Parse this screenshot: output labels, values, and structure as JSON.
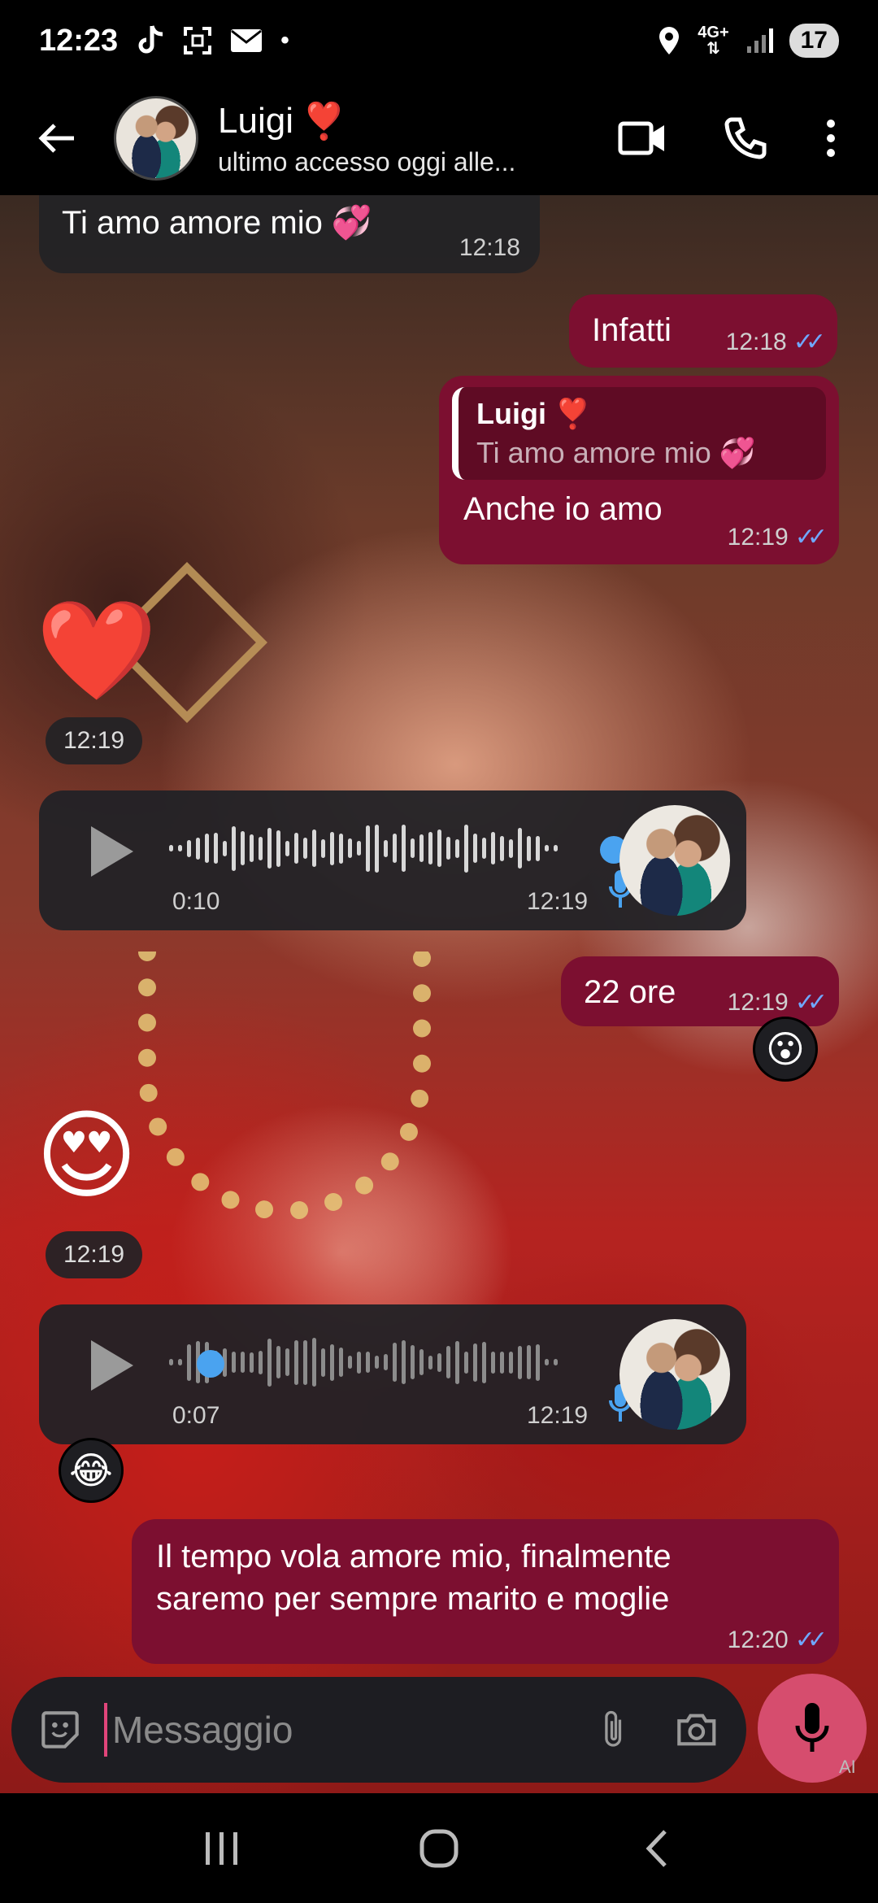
{
  "status_bar": {
    "time": "12:23",
    "network": "4G+",
    "battery": "17",
    "notification_icons": [
      "tiktok-icon",
      "screenshot-icon",
      "mail-icon",
      "dot-icon"
    ],
    "system_icons": [
      "location-icon",
      "network-arrows-icon",
      "signal-icon",
      "battery-icon"
    ]
  },
  "header": {
    "contact_name": "Luigi",
    "contact_emoji": "❣️",
    "last_seen": "ultimo accesso oggi alle...",
    "actions": [
      "video-call-icon",
      "voice-call-icon",
      "more-options-icon"
    ]
  },
  "messages": {
    "m1": {
      "text": "Ti amo amore mio 💞",
      "time": "12:18"
    },
    "m2": {
      "text": "Infatti",
      "time": "12:18"
    },
    "m3": {
      "reply_name": "Luigi ❣️",
      "reply_text": "Ti amo amore mio 💞",
      "text": "Anche io amo",
      "time": "12:19"
    },
    "m4": {
      "emoji": "❤️",
      "time": "12:19"
    },
    "m5": {
      "duration": "0:10",
      "time": "12:19",
      "progress": 1.0
    },
    "m6": {
      "text": "22 ore",
      "time": "12:19",
      "reaction": "😮"
    },
    "m7": {
      "emoji": "😍",
      "time": "12:19"
    },
    "m8": {
      "duration": "0:07",
      "time": "12:19",
      "progress": 0.0,
      "reaction": "😂"
    },
    "m9": {
      "line1": "Il tempo vola amore mio, finalmente",
      "line2": "saremo per sempre marito e moglie",
      "time": "12:20"
    }
  },
  "composer": {
    "placeholder": "Messaggio",
    "ai_mark": "AI"
  },
  "colors": {
    "outgoing_bubble": "#7c0f30",
    "incoming_bubble": "#222226",
    "read_ticks": "#6fa8ff",
    "mic_button": "#d64d6e",
    "voice_progress_dot": "#4aa3f0"
  }
}
